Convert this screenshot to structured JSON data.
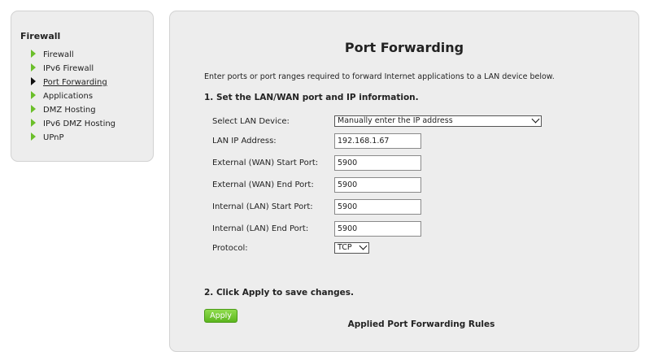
{
  "sidebar": {
    "title": "Firewall",
    "items": [
      {
        "label": "Firewall"
      },
      {
        "label": "IPv6 Firewall"
      },
      {
        "label": "Port Forwarding"
      },
      {
        "label": "Applications"
      },
      {
        "label": "DMZ Hosting"
      },
      {
        "label": "IPv6 DMZ Hosting"
      },
      {
        "label": "UPnP"
      }
    ],
    "active_item": "Port Forwarding"
  },
  "main": {
    "title": "Port Forwarding",
    "intro": "Enter ports or port ranges required to forward Internet applications to a LAN device below.",
    "step1": "1. Set the LAN/WAN port and IP information.",
    "form": {
      "select_lan_device_label": "Select LAN Device:",
      "select_lan_device_value": "Manually enter the IP address",
      "lan_ip_label": "LAN IP Address:",
      "lan_ip_value": "192.168.1.67",
      "ext_start_label": "External (WAN) Start Port:",
      "ext_start_value": "5900",
      "ext_end_label": "External (WAN) End Port:",
      "ext_end_value": "5900",
      "int_start_label": "Internal (LAN) Start Port:",
      "int_start_value": "5900",
      "int_end_label": "Internal (LAN) End Port:",
      "int_end_value": "5900",
      "protocol_label": "Protocol:",
      "protocol_value": "TCP"
    },
    "step2": "2. Click Apply to save changes.",
    "apply_label": "Apply",
    "rules_title": "Applied Port Forwarding Rules"
  },
  "colors": {
    "accent_green": "#6bbf2a",
    "panel_bg": "#ededed"
  }
}
